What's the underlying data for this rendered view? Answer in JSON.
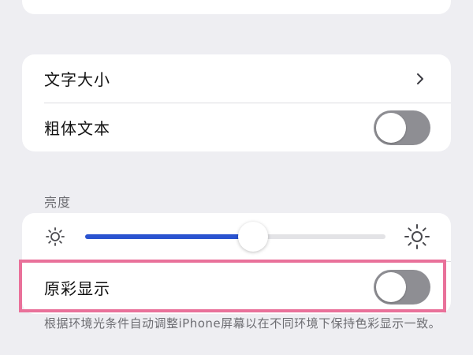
{
  "text_size_group": {
    "text_size_label": "文字大小",
    "bold_text_label": "粗体文本",
    "bold_text_enabled": false
  },
  "brightness_group": {
    "header": "亮度",
    "brightness_level": 0.56,
    "true_tone_label": "原彩显示",
    "true_tone_enabled": false,
    "footnote": "根据环境光条件自动调整iPhone屏幕以在不同环境下保持色彩显示一致。"
  },
  "colors": {
    "accent": "#2a53d0",
    "toggle_off": "#8e8e93",
    "highlight": "#e9719a"
  },
  "icons": {
    "chevron": "chevron-right-icon",
    "brightness_low": "sun-small-icon",
    "brightness_high": "sun-large-icon"
  }
}
